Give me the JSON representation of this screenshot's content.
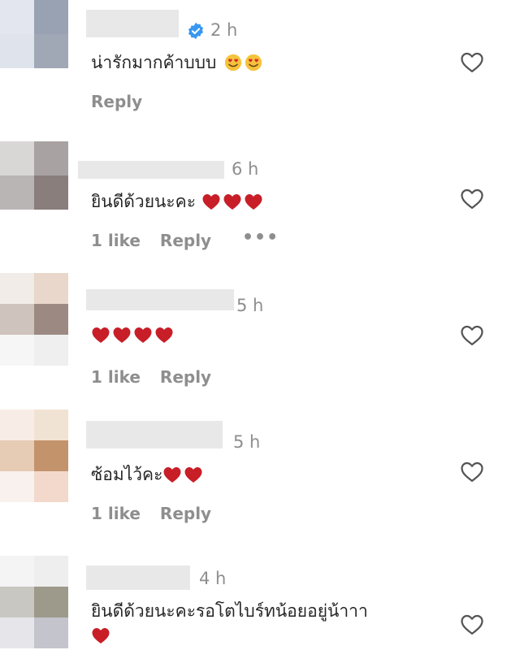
{
  "comments": [
    {
      "time": "2 h",
      "text": "น่ารักมากค้าบบบ",
      "emojis": [
        "smiling-face-with-heart-eyes",
        "smiling-face-with-heart-eyes"
      ],
      "likes": "",
      "reply_label": "Reply",
      "verified": true,
      "avatar_colors": [
        "#e3e6ee",
        "#99a2b2",
        "#dfe3eb",
        "#a0a8b6"
      ]
    },
    {
      "time": "6 h",
      "text": "ยินดีด้วยนะคะ",
      "emojis": [
        "red-heart",
        "red-heart",
        "red-heart"
      ],
      "likes": "1 like",
      "reply_label": "Reply",
      "more_label": "•••",
      "avatar_colors": [
        "#d9d6d6",
        "#a9a2a2",
        "#b9b5b5",
        "#8a7e7c"
      ]
    },
    {
      "time": "5 h",
      "text": "",
      "emojis": [
        "red-heart",
        "red-heart",
        "red-heart",
        "red-heart"
      ],
      "likes": "1 like",
      "reply_label": "Reply",
      "avatar_colors": [
        "#f2ece8",
        "#e8d7ca",
        "#cfc3bd",
        "#9c8a82"
      ]
    },
    {
      "time": "5 h",
      "text": "ซ้อมไว้คะ",
      "emojis": [
        "red-heart",
        "red-heart"
      ],
      "likes": "1 like",
      "reply_label": "Reply",
      "avatar_colors": [
        "#f8ede6",
        "#f1e3d4",
        "#e6cbb5",
        "#c3936c"
      ]
    },
    {
      "time": "4 h",
      "text": "ยินดีด้วยนะคะรอโตไบร์ทน้อยอยู่น้าาา",
      "emojis": [
        "red-heart"
      ],
      "likes": "",
      "reply_label": "",
      "avatar_colors": [
        "#c9c7c2",
        "#9d9a8c",
        "#e6e6ea",
        "#c4c4cc"
      ]
    }
  ],
  "colors": {
    "heart_red": "#c81e28",
    "muted_text": "#8e8e8e",
    "verified_blue": "#3897f0",
    "emoji_yellow": "#f5c33b"
  }
}
